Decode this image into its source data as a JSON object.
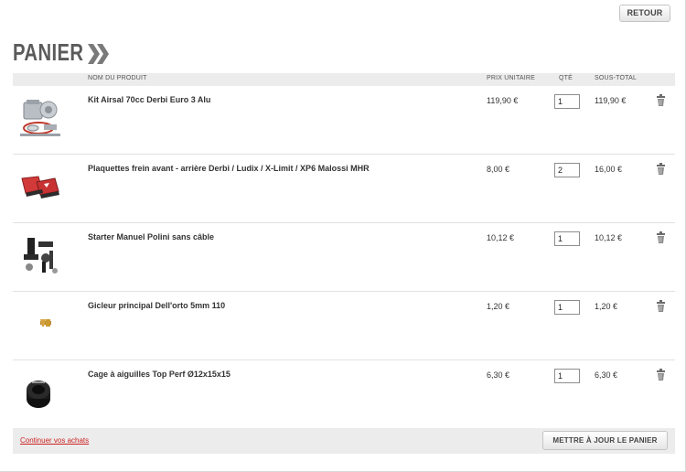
{
  "header": {
    "back_label": "RETOUR",
    "title": "PANIER"
  },
  "table": {
    "columns": {
      "product": "NOM DU PRODUIT",
      "unit_price": "PRIX UNITAIRE",
      "qty": "QTÉ",
      "subtotal": "SOUS-TOTAL"
    },
    "rows": [
      {
        "name": "Kit Airsal 70cc Derbi Euro 3 Alu",
        "unit_price": "119,90 €",
        "qty": "1",
        "subtotal": "119,90 €",
        "icon": "cylinder-kit-image"
      },
      {
        "name": "Plaquettes frein avant - arrière Derbi / Ludix / X-Limit / XP6 Malossi MHR",
        "unit_price": "8,00 €",
        "qty": "2",
        "subtotal": "16,00 €",
        "icon": "brake-pads-image"
      },
      {
        "name": "Starter Manuel Polini sans câble",
        "unit_price": "10,12 €",
        "qty": "1",
        "subtotal": "10,12 €",
        "icon": "starter-kit-image"
      },
      {
        "name": "Gicleur principal Dell'orto 5mm 110",
        "unit_price": "1,20 €",
        "qty": "1",
        "subtotal": "1,20 €",
        "icon": "jet-image"
      },
      {
        "name": "Cage à aiguilles Top Perf Ø12x15x15",
        "unit_price": "6,30 €",
        "qty": "1",
        "subtotal": "6,30 €",
        "icon": "needle-bearing-image"
      }
    ]
  },
  "footer": {
    "continue_label": "Continuer vos achats",
    "update_label": "METTRE À JOUR LE PANIER"
  },
  "colors": {
    "link": "#cc2222",
    "title": "#5b5b5b",
    "header_bg": "#ececec"
  }
}
